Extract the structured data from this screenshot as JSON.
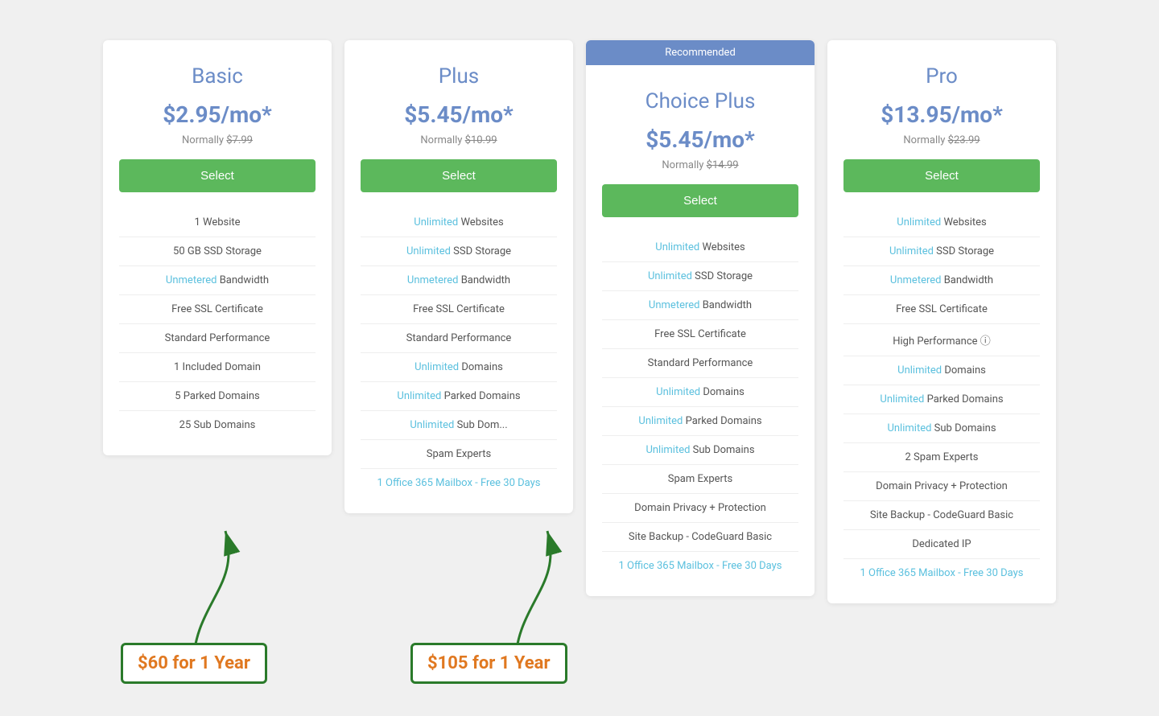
{
  "plans": [
    {
      "id": "basic",
      "name": "Basic",
      "price": "$2.95/mo*",
      "normal_price": "$7.99",
      "select_label": "Select",
      "recommended": false,
      "features": [
        {
          "text": "1 Website",
          "highlight": false
        },
        {
          "text": "50 GB SSD Storage",
          "highlight": false
        },
        {
          "text": "Unmetered",
          "highlight": true,
          "suffix": " Bandwidth"
        },
        {
          "text": "Free SSL Certificate",
          "highlight": false
        },
        {
          "text": "Standard Performance",
          "highlight": false
        },
        {
          "text": "1 Included Domain",
          "highlight": false
        },
        {
          "text": "5 Parked Domains",
          "highlight": false
        },
        {
          "text": "25 Sub Domains",
          "highlight": false
        }
      ]
    },
    {
      "id": "plus",
      "name": "Plus",
      "price": "$5.45/mo*",
      "normal_price": "$10.99",
      "select_label": "Select",
      "recommended": false,
      "features": [
        {
          "text": "Unlimited",
          "highlight": true,
          "suffix": " Websites"
        },
        {
          "text": "Unlimited",
          "highlight": true,
          "suffix": " SSD Storage"
        },
        {
          "text": "Unmetered",
          "highlight": true,
          "suffix": " Bandwidth"
        },
        {
          "text": "Free SSL Certificate",
          "highlight": false
        },
        {
          "text": "Standard Performance",
          "highlight": false
        },
        {
          "text": "Unlimited",
          "highlight": true,
          "suffix": " Domains"
        },
        {
          "text": "Unlimited",
          "highlight": true,
          "suffix": " Parked Domains"
        },
        {
          "text": "Unlimited",
          "highlight": true,
          "suffix": " Sub Dom..."
        },
        {
          "text": "Spam Experts",
          "highlight": false
        },
        {
          "text": "1 Office 365 Mailbox - Free 30 Days",
          "highlight": true
        }
      ]
    },
    {
      "id": "choice-plus",
      "name": "Choice Plus",
      "price": "$5.45/mo*",
      "normal_price": "$14.99",
      "select_label": "Select",
      "recommended": true,
      "features": [
        {
          "text": "Unlimited",
          "highlight": true,
          "suffix": " Websites"
        },
        {
          "text": "Unlimited",
          "highlight": true,
          "suffix": " SSD Storage"
        },
        {
          "text": "Unmetered",
          "highlight": true,
          "suffix": " Bandwidth"
        },
        {
          "text": "Free SSL Certificate",
          "highlight": false
        },
        {
          "text": "Standard Performance",
          "highlight": false
        },
        {
          "text": "Unlimited",
          "highlight": true,
          "suffix": " Domains"
        },
        {
          "text": "Unlimited",
          "highlight": true,
          "suffix": " Parked Domains"
        },
        {
          "text": "Unlimited",
          "highlight": true,
          "suffix": " Sub Domains"
        },
        {
          "text": "Spam Experts",
          "highlight": false
        },
        {
          "text": "Domain Privacy + Protection",
          "highlight": false
        },
        {
          "text": "Site Backup - CodeGuard Basic",
          "highlight": false
        },
        {
          "text": "1 Office 365 Mailbox - Free 30 Days",
          "highlight": true
        }
      ]
    },
    {
      "id": "pro",
      "name": "Pro",
      "price": "$13.95/mo*",
      "normal_price": "$23.99",
      "select_label": "Select",
      "recommended": false,
      "features": [
        {
          "text": "Unlimited",
          "highlight": true,
          "suffix": " Websites"
        },
        {
          "text": "Unlimited",
          "highlight": true,
          "suffix": " SSD Storage"
        },
        {
          "text": "Unmetered",
          "highlight": true,
          "suffix": " Bandwidth"
        },
        {
          "text": "Free SSL Certificate",
          "highlight": false
        },
        {
          "text": "High Performance",
          "highlight": false,
          "suffix": " ⓘ"
        },
        {
          "text": "Unlimited",
          "highlight": true,
          "suffix": " Domains"
        },
        {
          "text": "Unlimited",
          "highlight": true,
          "suffix": " Parked Domains"
        },
        {
          "text": "Unlimited",
          "highlight": true,
          "suffix": " Sub Domains"
        },
        {
          "text": "2 Spam Experts",
          "highlight": false
        },
        {
          "text": "Domain Privacy + Protection",
          "highlight": false
        },
        {
          "text": "Site Backup - CodeGuard Basic",
          "highlight": false
        },
        {
          "text": "Dedicated IP",
          "highlight": false
        },
        {
          "text": "1 Office 365 Mailbox - Free 30 Days",
          "highlight": true
        }
      ]
    }
  ],
  "annotations": {
    "basic": "$60 for 1 Year",
    "plus": "$105 for 1 Year"
  },
  "recommended_label": "Recommended"
}
